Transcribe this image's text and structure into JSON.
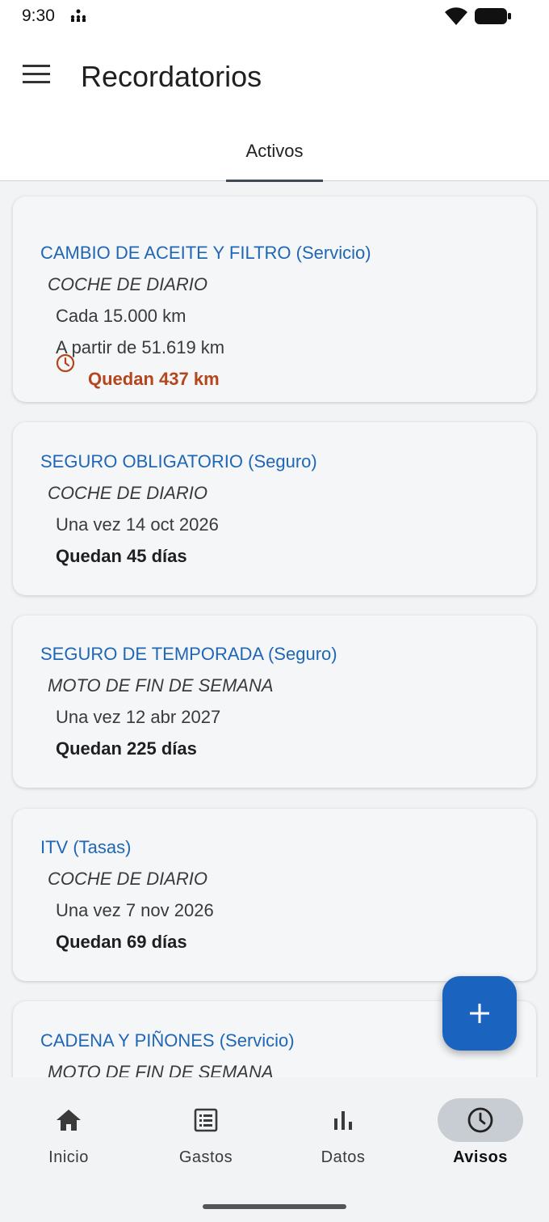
{
  "status_bar": {
    "time": "9:30",
    "icons": [
      "notification-icon",
      "wifi-icon",
      "battery-icon"
    ]
  },
  "app_bar": {
    "menu_icon": "hamburger-menu-icon",
    "title": "Recordatorios"
  },
  "tabs": [
    {
      "label": "Activos",
      "selected": true
    }
  ],
  "reminders": [
    {
      "name": "CAMBIO DE ACEITE Y FILTRO (Servicio)",
      "vehicle": "COCHE DE DIARIO",
      "line1": "Cada 15.000 km",
      "line2": "A partir de 51.619 km",
      "remaining": "Quedan 437 km",
      "alert": true
    },
    {
      "name": "SEGURO OBLIGATORIO (Seguro)",
      "vehicle": "COCHE DE DIARIO",
      "line1": "Una vez 14 oct 2026",
      "remaining": "Quedan 45 días",
      "alert": false
    },
    {
      "name": "SEGURO DE TEMPORADA (Seguro)",
      "vehicle": "MOTO DE FIN DE SEMANA",
      "line1": "Una vez 12 abr 2027",
      "remaining": "Quedan 225 días",
      "alert": false
    },
    {
      "name": "ITV (Tasas)",
      "vehicle": "COCHE DE DIARIO",
      "line1": "Una vez 7 nov 2026",
      "remaining": "Quedan 69 días",
      "alert": false
    },
    {
      "name": "CADENA Y PIÑONES (Servicio)",
      "vehicle": "MOTO DE FIN DE SEMANA"
    }
  ],
  "fab": {
    "icon": "plus-icon"
  },
  "bottom_nav": [
    {
      "label": "Inicio",
      "icon": "home-icon",
      "active": false
    },
    {
      "label": "Gastos",
      "icon": "receipt-list-icon",
      "active": false
    },
    {
      "label": "Datos",
      "icon": "bar-chart-icon",
      "active": false
    },
    {
      "label": "Avisos",
      "icon": "clock-icon",
      "active": true
    }
  ],
  "colors": {
    "link_blue": "#1f66b5",
    "alert_orange": "#b5451b",
    "fab_blue": "#1a64c0",
    "active_pill": "#c8cdd3"
  }
}
